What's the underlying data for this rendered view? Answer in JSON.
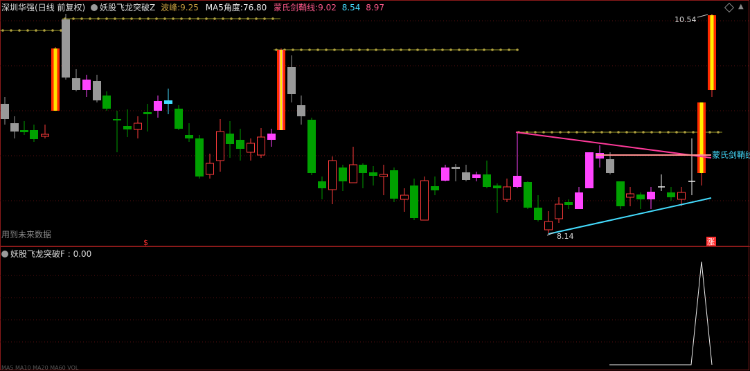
{
  "header": {
    "stock": "深圳华强",
    "period": "(日线 前复权)",
    "indicator": "妖股飞龙突破Z",
    "bofeng_label": "波峰:",
    "bofeng_value": "9.25",
    "ma5_label": "MA5角度:",
    "ma5_value": "76.80",
    "jianqiao_label": "蒙氏剑鞘线:",
    "jianqiao_v1": "9.02",
    "jianqiao_v2": "8.54",
    "jianqiao_v3": "8.97"
  },
  "main": {
    "high_label": "10.54",
    "low_label": "8.14",
    "future_data_label": "用到未来数据",
    "jianqiao_line_label": "蒙氏剑鞘线",
    "s_marker": "$",
    "zhang_marker": "涨"
  },
  "sub": {
    "indicator": "妖股飞龙突破F",
    "value": ": 0.00"
  },
  "bottom_strip": "MA5 MA10 MA20 MA60 VOL",
  "colors": {
    "up": "#ff3b3b",
    "down": "#00a000",
    "pink": "#ff44ff",
    "gray": "#999999",
    "cyan": "#44ddff",
    "gold": "#a0a030",
    "yellow": "#ffee00"
  }
}
